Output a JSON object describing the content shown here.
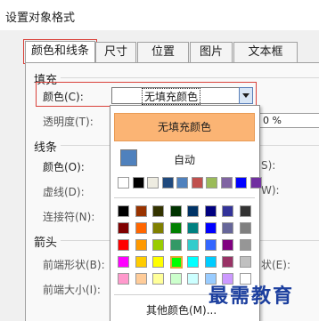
{
  "dialog": {
    "title": "设置对象格式"
  },
  "tabs": [
    {
      "label": "颜色和线条",
      "active": true
    },
    {
      "label": "尺寸",
      "active": false
    },
    {
      "label": "位置",
      "active": false
    },
    {
      "label": "图片",
      "active": false
    },
    {
      "label": "文本框",
      "active": false
    }
  ],
  "fill": {
    "section": "填充",
    "color_label": "颜色(C):",
    "color_value": "无填充颜色",
    "transparency_label": "透明度(T):",
    "transparency_value": "0 %"
  },
  "line": {
    "section": "线条",
    "color_label": "颜色(O):",
    "dash_label": "虚线(D):",
    "connector_label": "连接符(N):",
    "right_suffix_1": "S):",
    "right_suffix_2": "W):"
  },
  "arrows": {
    "section": "箭头",
    "begin_style_label": "前端形状(B):",
    "begin_size_label": "前端大小(I):",
    "end_style_suffix": "状(E):"
  },
  "popup": {
    "no_fill_label": "无填充颜色",
    "auto_label": "自动",
    "auto_color": "#4f81bd",
    "recent_colors": [
      "#ffffff",
      "#000000",
      "#eeece1",
      "#1f497d",
      "#4f81bd",
      "#c0504d",
      "#9bbb59",
      "#8064a2",
      "#0000ff",
      "#7030a0"
    ],
    "palette": [
      [
        "#000000",
        "#993300",
        "#333300",
        "#003300",
        "#003366",
        "#000080",
        "#333399",
        "#333333"
      ],
      [
        "#800000",
        "#ff6600",
        "#808000",
        "#008000",
        "#008080",
        "#0000ff",
        "#666699",
        "#808080"
      ],
      [
        "#ff0000",
        "#ff9900",
        "#99cc00",
        "#339966",
        "#33cccc",
        "#3366ff",
        "#800080",
        "#969696"
      ],
      [
        "#ff00ff",
        "#ffcc00",
        "#ffff00",
        "#00ff00",
        "#00ffff",
        "#00ccff",
        "#993366",
        "#c0c0c0"
      ],
      [
        "#ff99cc",
        "#ffcc99",
        "#ffff99",
        "#ccffcc",
        "#ccffff",
        "#99ccff",
        "#cc99ff",
        "#ffffff"
      ]
    ],
    "selected_swatch": "#00ff00",
    "more_colors_label": "其他颜色(M)..."
  },
  "watermark": "最需教育"
}
